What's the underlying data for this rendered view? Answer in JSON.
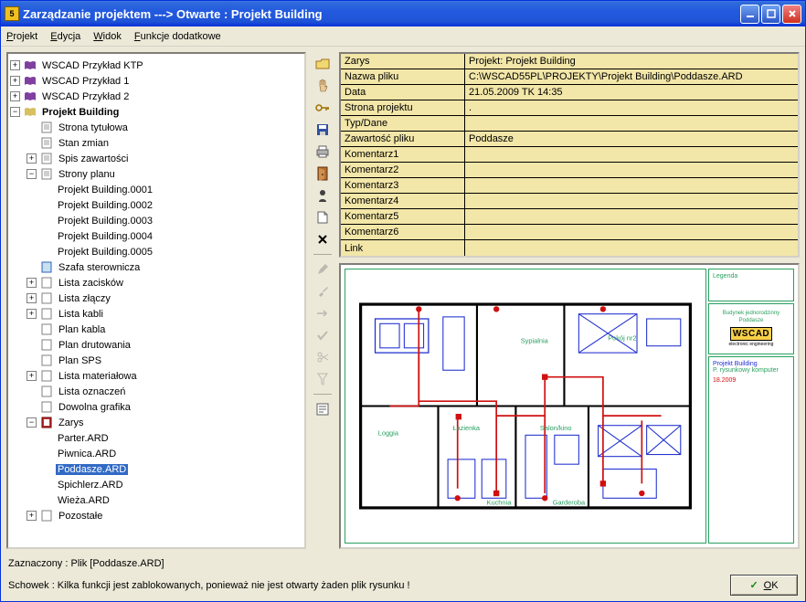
{
  "window": {
    "title": "Zarządzanie projektem   ---> Otwarte : Projekt Building"
  },
  "menu": {
    "project": "Projekt",
    "edit": "Edycja",
    "view": "Widok",
    "extras": "Funkcje dodatkowe"
  },
  "tree": {
    "n0": "WSCAD Przykład KTP",
    "n1": "WSCAD Przykład 1",
    "n2": "WSCAD Przykład 2",
    "n3": "Projekt Building",
    "n3_0": "Strona tytułowa",
    "n3_1": "Stan zmian",
    "n3_2": "Spis zawartości",
    "n3_3": "Strony planu",
    "n3_3_0": "Projekt Building.0001",
    "n3_3_1": "Projekt Building.0002",
    "n3_3_2": "Projekt Building.0003",
    "n3_3_3": "Projekt Building.0004",
    "n3_3_4": "Projekt Building.0005",
    "n3_4": "Szafa sterownicza",
    "n3_5": "Lista zacisków",
    "n3_6": "Lista złączy",
    "n3_7": "Lista kabli",
    "n3_8": "Plan kabla",
    "n3_9": "Plan drutowania",
    "n3_10": "Plan SPS",
    "n3_11": "Lista materiałowa",
    "n3_12": "Lista oznaczeń",
    "n3_13": "Dowolna grafika",
    "n3_14": "Zarys",
    "n3_14_0": "Parter.ARD",
    "n3_14_1": "Piwnica.ARD",
    "n3_14_2": "Poddasze.ARD",
    "n3_14_3": "Spichlerz.ARD",
    "n3_14_4": "Wieża.ARD",
    "n3_15": "Pozostałe"
  },
  "props": {
    "rows": [
      {
        "k": "Zarys",
        "v": "Projekt: Projekt Building"
      },
      {
        "k": "Nazwa pliku",
        "v": "C:\\WSCAD55PL\\PROJEKTY\\Projekt Building\\Poddasze.ARD"
      },
      {
        "k": "Data",
        "v": "21.05.2009  TK  14:35"
      },
      {
        "k": "Strona projektu",
        "v": "."
      },
      {
        "k": "Typ/Dane",
        "v": ""
      },
      {
        "k": "Zawartość pliku",
        "v": "Poddasze"
      },
      {
        "k": "Komentarz1",
        "v": ""
      },
      {
        "k": "Komentarz2",
        "v": ""
      },
      {
        "k": "Komentarz3",
        "v": ""
      },
      {
        "k": "Komentarz4",
        "v": ""
      },
      {
        "k": "Komentarz5",
        "v": ""
      },
      {
        "k": "Komentarz6",
        "v": ""
      },
      {
        "k": "Link",
        "v": ""
      }
    ]
  },
  "preview": {
    "legend_title": "Legenda",
    "desc1": "Budynek jednorodzinny",
    "desc2": "Poddasze",
    "logo_text": "WSCAD",
    "meta_title": "Projekt Building",
    "meta_sub": "P. rysunkowy komputer",
    "meta_date": "18.2009",
    "room1": "Sypialnia",
    "room2": "Pokój nr2",
    "room3": "Loggia",
    "room4": "Łazienka",
    "room5": "Kuchnia",
    "room6": "Garderoba",
    "room7": "Salon/kino"
  },
  "status": {
    "line1": "Zaznaczony : Plik [Poddasze.ARD]",
    "line2": "Schowek : Kilka funkcji jest zablokowanych, ponieważ nie jest otwarty żaden plik rysunku !",
    "ok": "OK"
  }
}
